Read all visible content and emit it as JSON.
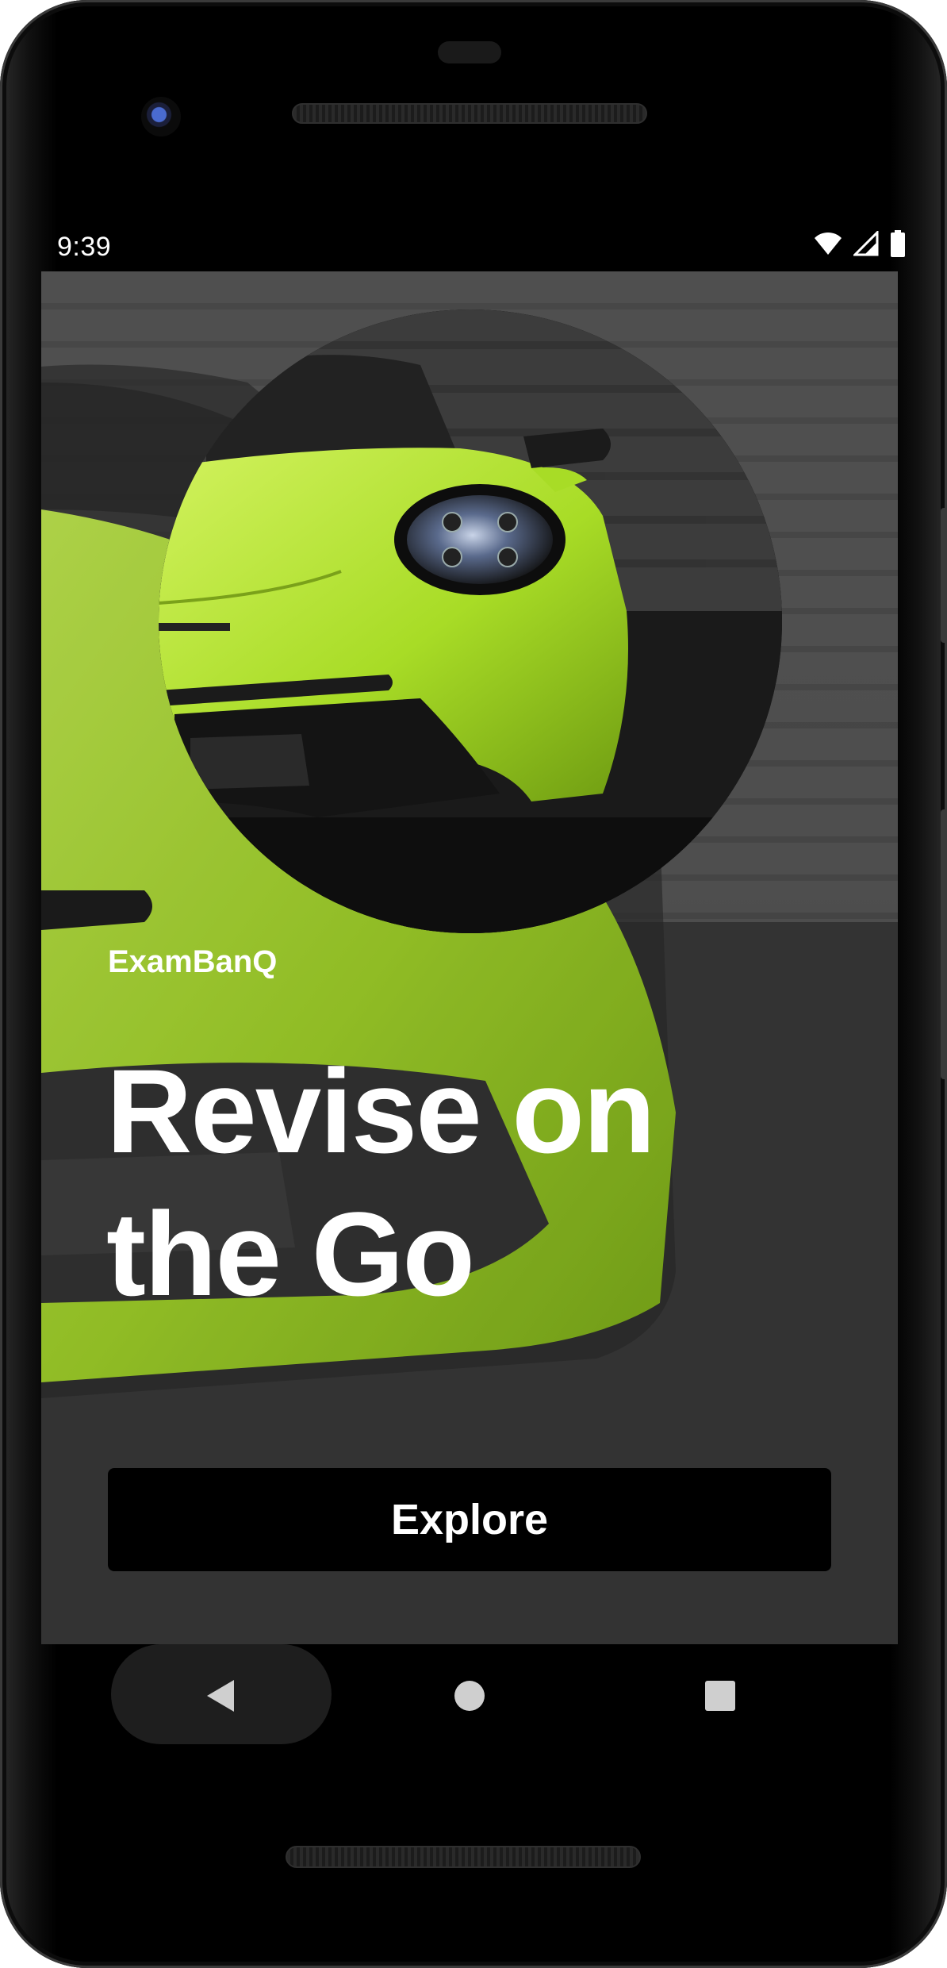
{
  "status_bar": {
    "time": "9:39",
    "icons": [
      "wifi-icon",
      "cellular-signal-icon",
      "battery-icon"
    ]
  },
  "app": {
    "brand": "ExamBanQ",
    "headline": "Revise on the Go",
    "explore_label": "Explore",
    "accent_color": "#b7e630"
  },
  "nav_bar": {
    "buttons": [
      "back-icon",
      "home-icon",
      "recents-icon"
    ]
  }
}
